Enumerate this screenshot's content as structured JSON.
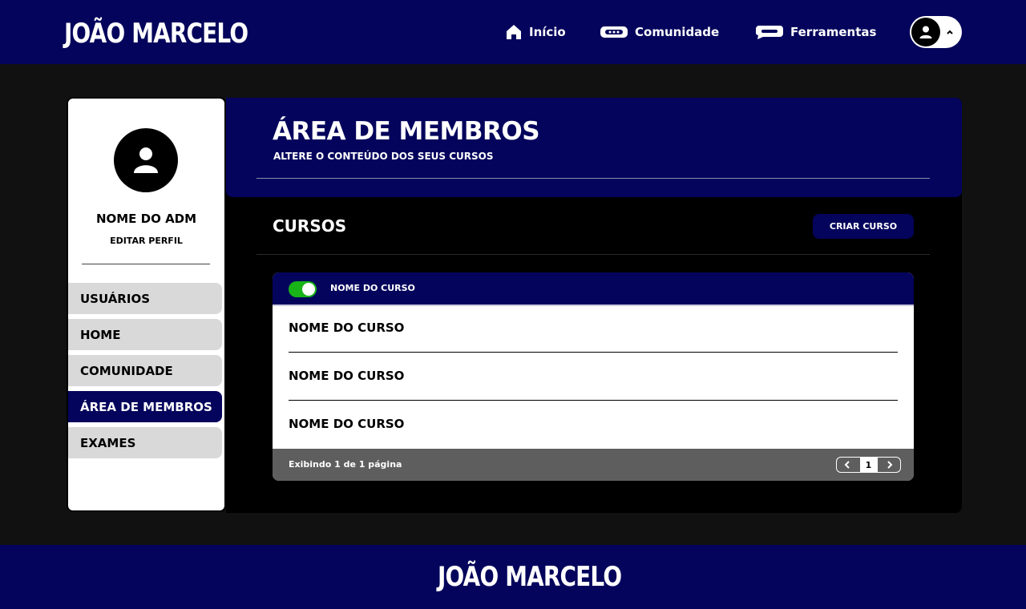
{
  "brand": {
    "logo_text": "JOÃO MARCELO"
  },
  "nav": {
    "items": [
      {
        "label": "Início",
        "icon": "home-icon"
      },
      {
        "label": "Comunidade",
        "icon": "community-icon"
      },
      {
        "label": "Ferramentas",
        "icon": "tools-icon"
      }
    ],
    "user_menu_icon": "user-icon"
  },
  "sidebar": {
    "admin_name": "NOME DO ADM",
    "edit_profile": "EDITAR PERFIL",
    "items": [
      {
        "label": "USUÁRIOS",
        "active": false
      },
      {
        "label": "HOME",
        "active": false
      },
      {
        "label": "COMUNIDADE",
        "active": false
      },
      {
        "label": "ÁREA DE MEMBROS",
        "active": true
      },
      {
        "label": "EXAMES",
        "active": false
      }
    ]
  },
  "hero": {
    "title": "ÁREA DE MEMBROS",
    "subtitle": "ALTERE O CONTEÚDO DOS SEUS CURSOS"
  },
  "courses": {
    "section_title": "CURSOS",
    "create_button": "CRIAR CURSO",
    "header_label": "NOME DO CURSO",
    "toggle_on": true,
    "rows": [
      "NOME DO CURSO",
      "NOME DO CURSO",
      "NOME DO CURSO"
    ],
    "footer_text": "Exibindo 1 de 1 página",
    "current_page": "1"
  },
  "colors": {
    "brand_navy": "#04045c",
    "toggle_green": "#18b418",
    "background": "#111111"
  }
}
